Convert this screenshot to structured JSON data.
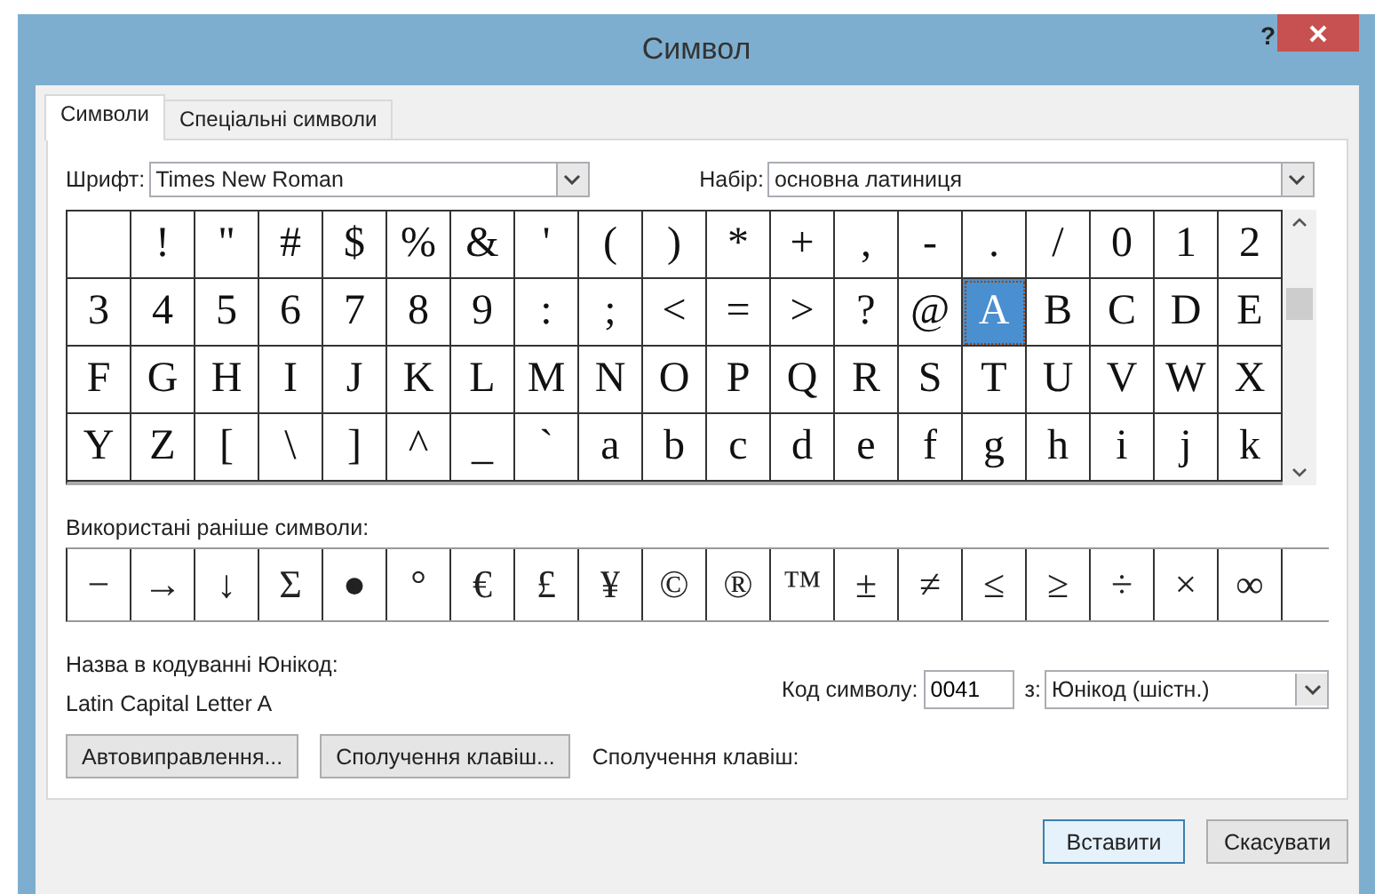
{
  "window": {
    "title": "Символ",
    "help": "?"
  },
  "tabs": [
    {
      "label": "Символи",
      "selected": true
    },
    {
      "label": "Спеціальні символи",
      "selected": false
    }
  ],
  "font": {
    "label": "Шрифт:",
    "value": "Times New Roman"
  },
  "subset": {
    "label": "Набір:",
    "value": "основна латиниця"
  },
  "grid": [
    [
      {
        "selected": false
      },
      {
        "char": "!",
        "selected": false
      },
      {
        "char": "\"",
        "selected": false
      },
      {
        "char": "#",
        "selected": false
      },
      {
        "char": "$",
        "selected": false
      },
      {
        "char": "%",
        "selected": false
      },
      {
        "char": "&",
        "selected": false
      },
      {
        "char": "'",
        "selected": false
      },
      {
        "char": "(",
        "selected": false
      },
      {
        "char": ")",
        "selected": false
      },
      {
        "char": "*",
        "selected": false
      },
      {
        "char": "+",
        "selected": false
      },
      {
        "char": ",",
        "selected": false
      },
      {
        "char": "-",
        "selected": false
      },
      {
        "char": ".",
        "selected": false
      },
      {
        "char": "/",
        "selected": false
      },
      {
        "char": "0",
        "selected": false
      },
      {
        "char": "1",
        "selected": false
      },
      {
        "char": "2",
        "selected": false
      }
    ],
    [
      {
        "char": "3",
        "selected": false
      },
      {
        "char": "4",
        "selected": false
      },
      {
        "char": "5",
        "selected": false
      },
      {
        "char": "6",
        "selected": false
      },
      {
        "char": "7",
        "selected": false
      },
      {
        "char": "8",
        "selected": false
      },
      {
        "char": "9",
        "selected": false
      },
      {
        "char": ":",
        "selected": false
      },
      {
        "char": ";",
        "selected": false
      },
      {
        "char": "<",
        "selected": false
      },
      {
        "char": "=",
        "selected": false
      },
      {
        "char": ">",
        "selected": false
      },
      {
        "char": "?",
        "selected": false
      },
      {
        "char": "@",
        "selected": false
      },
      {
        "char": "A",
        "selected": true
      },
      {
        "char": "B",
        "selected": false
      },
      {
        "char": "C",
        "selected": false
      },
      {
        "char": "D",
        "selected": false
      },
      {
        "char": "E",
        "selected": false
      }
    ],
    [
      {
        "char": "F",
        "selected": false
      },
      {
        "char": "G",
        "selected": false
      },
      {
        "char": "H",
        "selected": false
      },
      {
        "char": "I",
        "selected": false
      },
      {
        "char": "J",
        "selected": false
      },
      {
        "char": "K",
        "selected": false
      },
      {
        "char": "L",
        "selected": false
      },
      {
        "char": "M",
        "selected": false
      },
      {
        "char": "N",
        "selected": false
      },
      {
        "char": "O",
        "selected": false
      },
      {
        "char": "P",
        "selected": false
      },
      {
        "char": "Q",
        "selected": false
      },
      {
        "char": "R",
        "selected": false
      },
      {
        "char": "S",
        "selected": false
      },
      {
        "char": "T",
        "selected": false
      },
      {
        "char": "U",
        "selected": false
      },
      {
        "char": "V",
        "selected": false
      },
      {
        "char": "W",
        "selected": false
      },
      {
        "char": "X",
        "selected": false
      }
    ],
    [
      {
        "char": "Y",
        "selected": false
      },
      {
        "char": "Z",
        "selected": false
      },
      {
        "char": "[",
        "selected": false
      },
      {
        "char": "\\",
        "selected": false
      },
      {
        "char": "]",
        "selected": false
      },
      {
        "char": "^",
        "selected": false
      },
      {
        "char": "_",
        "selected": false
      },
      {
        "char": "`",
        "selected": false
      },
      {
        "char": "a",
        "selected": false
      },
      {
        "char": "b",
        "selected": false
      },
      {
        "char": "c",
        "selected": false
      },
      {
        "char": "d",
        "selected": false
      },
      {
        "char": "e",
        "selected": false
      },
      {
        "char": "f",
        "selected": false
      },
      {
        "char": "g",
        "selected": false
      },
      {
        "char": "h",
        "selected": false
      },
      {
        "char": "i",
        "selected": false
      },
      {
        "char": "j",
        "selected": false
      },
      {
        "char": "k",
        "selected": false
      }
    ]
  ],
  "recent": {
    "label": "Використані раніше символи:",
    "symbols": [
      "−",
      "→",
      "↓",
      "Σ",
      "●",
      "°",
      "€",
      "£",
      "¥",
      "©",
      "®",
      "™",
      "±",
      "≠",
      "≤",
      "≥",
      "÷",
      "×",
      "∞"
    ]
  },
  "unicode_name": {
    "label": "Назва в кодуванні Юнікод:",
    "value": "Latin Capital Letter A"
  },
  "char_code": {
    "label": "Код символу:",
    "value": "0041"
  },
  "from": {
    "label": "з:",
    "value": "Юнікод (шістн.)"
  },
  "autocorrect_button": "Автовиправлення...",
  "shortcut_button": "Сполучення клавіш...",
  "shortcut_label": "Сполучення клавіш:",
  "buttons": [
    {
      "label": "Вставити",
      "default": true
    },
    {
      "label": "Скасувати",
      "default": false
    }
  ]
}
